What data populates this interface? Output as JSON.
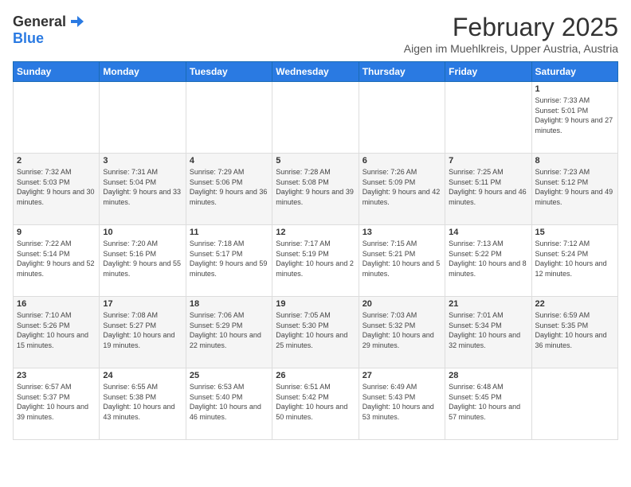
{
  "header": {
    "logo_general": "General",
    "logo_blue": "Blue",
    "title": "February 2025",
    "subtitle": "Aigen im Muehlkreis, Upper Austria, Austria"
  },
  "weekdays": [
    "Sunday",
    "Monday",
    "Tuesday",
    "Wednesday",
    "Thursday",
    "Friday",
    "Saturday"
  ],
  "weeks": [
    [
      {
        "day": "",
        "content": ""
      },
      {
        "day": "",
        "content": ""
      },
      {
        "day": "",
        "content": ""
      },
      {
        "day": "",
        "content": ""
      },
      {
        "day": "",
        "content": ""
      },
      {
        "day": "",
        "content": ""
      },
      {
        "day": "1",
        "content": "Sunrise: 7:33 AM\nSunset: 5:01 PM\nDaylight: 9 hours and 27 minutes."
      }
    ],
    [
      {
        "day": "2",
        "content": "Sunrise: 7:32 AM\nSunset: 5:03 PM\nDaylight: 9 hours and 30 minutes."
      },
      {
        "day": "3",
        "content": "Sunrise: 7:31 AM\nSunset: 5:04 PM\nDaylight: 9 hours and 33 minutes."
      },
      {
        "day": "4",
        "content": "Sunrise: 7:29 AM\nSunset: 5:06 PM\nDaylight: 9 hours and 36 minutes."
      },
      {
        "day": "5",
        "content": "Sunrise: 7:28 AM\nSunset: 5:08 PM\nDaylight: 9 hours and 39 minutes."
      },
      {
        "day": "6",
        "content": "Sunrise: 7:26 AM\nSunset: 5:09 PM\nDaylight: 9 hours and 42 minutes."
      },
      {
        "day": "7",
        "content": "Sunrise: 7:25 AM\nSunset: 5:11 PM\nDaylight: 9 hours and 46 minutes."
      },
      {
        "day": "8",
        "content": "Sunrise: 7:23 AM\nSunset: 5:12 PM\nDaylight: 9 hours and 49 minutes."
      }
    ],
    [
      {
        "day": "9",
        "content": "Sunrise: 7:22 AM\nSunset: 5:14 PM\nDaylight: 9 hours and 52 minutes."
      },
      {
        "day": "10",
        "content": "Sunrise: 7:20 AM\nSunset: 5:16 PM\nDaylight: 9 hours and 55 minutes."
      },
      {
        "day": "11",
        "content": "Sunrise: 7:18 AM\nSunset: 5:17 PM\nDaylight: 9 hours and 59 minutes."
      },
      {
        "day": "12",
        "content": "Sunrise: 7:17 AM\nSunset: 5:19 PM\nDaylight: 10 hours and 2 minutes."
      },
      {
        "day": "13",
        "content": "Sunrise: 7:15 AM\nSunset: 5:21 PM\nDaylight: 10 hours and 5 minutes."
      },
      {
        "day": "14",
        "content": "Sunrise: 7:13 AM\nSunset: 5:22 PM\nDaylight: 10 hours and 8 minutes."
      },
      {
        "day": "15",
        "content": "Sunrise: 7:12 AM\nSunset: 5:24 PM\nDaylight: 10 hours and 12 minutes."
      }
    ],
    [
      {
        "day": "16",
        "content": "Sunrise: 7:10 AM\nSunset: 5:26 PM\nDaylight: 10 hours and 15 minutes."
      },
      {
        "day": "17",
        "content": "Sunrise: 7:08 AM\nSunset: 5:27 PM\nDaylight: 10 hours and 19 minutes."
      },
      {
        "day": "18",
        "content": "Sunrise: 7:06 AM\nSunset: 5:29 PM\nDaylight: 10 hours and 22 minutes."
      },
      {
        "day": "19",
        "content": "Sunrise: 7:05 AM\nSunset: 5:30 PM\nDaylight: 10 hours and 25 minutes."
      },
      {
        "day": "20",
        "content": "Sunrise: 7:03 AM\nSunset: 5:32 PM\nDaylight: 10 hours and 29 minutes."
      },
      {
        "day": "21",
        "content": "Sunrise: 7:01 AM\nSunset: 5:34 PM\nDaylight: 10 hours and 32 minutes."
      },
      {
        "day": "22",
        "content": "Sunrise: 6:59 AM\nSunset: 5:35 PM\nDaylight: 10 hours and 36 minutes."
      }
    ],
    [
      {
        "day": "23",
        "content": "Sunrise: 6:57 AM\nSunset: 5:37 PM\nDaylight: 10 hours and 39 minutes."
      },
      {
        "day": "24",
        "content": "Sunrise: 6:55 AM\nSunset: 5:38 PM\nDaylight: 10 hours and 43 minutes."
      },
      {
        "day": "25",
        "content": "Sunrise: 6:53 AM\nSunset: 5:40 PM\nDaylight: 10 hours and 46 minutes."
      },
      {
        "day": "26",
        "content": "Sunrise: 6:51 AM\nSunset: 5:42 PM\nDaylight: 10 hours and 50 minutes."
      },
      {
        "day": "27",
        "content": "Sunrise: 6:49 AM\nSunset: 5:43 PM\nDaylight: 10 hours and 53 minutes."
      },
      {
        "day": "28",
        "content": "Sunrise: 6:48 AM\nSunset: 5:45 PM\nDaylight: 10 hours and 57 minutes."
      },
      {
        "day": "",
        "content": ""
      }
    ]
  ]
}
